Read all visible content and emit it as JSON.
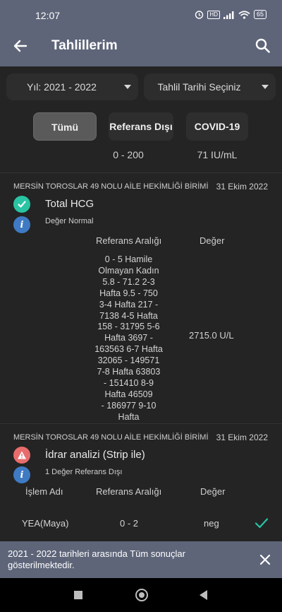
{
  "status_bar": {
    "time": "12:07",
    "network_badge": "HD",
    "battery": "65"
  },
  "app_bar": {
    "title": "Tahlillerim"
  },
  "filters": {
    "year": "Yıl: 2021 - 2022",
    "date": "Tahlil Tarihi Seçiniz"
  },
  "chips": [
    {
      "label": "Tümü",
      "sub": ""
    },
    {
      "label": "Referans Dışı",
      "sub": "0 - 200"
    },
    {
      "label": "COVID-19",
      "sub": "71 IU/mL"
    }
  ],
  "cards": [
    {
      "institution": "MERSİN TOROSLAR 49 NOLU AİLE HEKİMLİĞİ BİRİMİ",
      "date": "31 Ekim 2022",
      "test_name": "Total HCG",
      "status": "Değer Normal",
      "col_ref": "Referans Aralığı",
      "col_value": "Değer",
      "reference": "0 - 5   Hamile\nOlmayan Kadın\n5.8 - 71.2   2-3\nHafta   9.5 - 750\n3-4 Hafta   217 -\n7138   4-5 Hafta\n158 - 31795   5-6\nHafta   3697 -\n163563   6-7 Hafta\n32065 - 149571\n7-8 Hafta   63803\n- 151410   8-9\nHafta   46509\n- 186977   9-10\nHafta",
      "value": "2715.0 U/L"
    },
    {
      "institution": "MERSİN TOROSLAR 49 NOLU AİLE HEKİMLİĞİ BİRİMİ",
      "date": "31 Ekim 2022",
      "test_name": "İdrar analizi (Strip ile)",
      "status": "1 Değer Referans Dışı",
      "col_name": "İşlem Adı",
      "col_ref": "Referans Aralığı",
      "col_value": "Değer",
      "rows": [
        {
          "name": "YEA(Maya)",
          "ref": "0 - 2",
          "value": "neg"
        }
      ]
    }
  ],
  "snackbar": {
    "message": "2021 - 2022 tarihleri arasında Tüm sonuçlar gösterilmektedir."
  },
  "colors": {
    "primary": "#5e6579",
    "background": "#242424",
    "success": "#29c4a4",
    "warning": "#e86c6c",
    "info": "#3f7ac4"
  }
}
